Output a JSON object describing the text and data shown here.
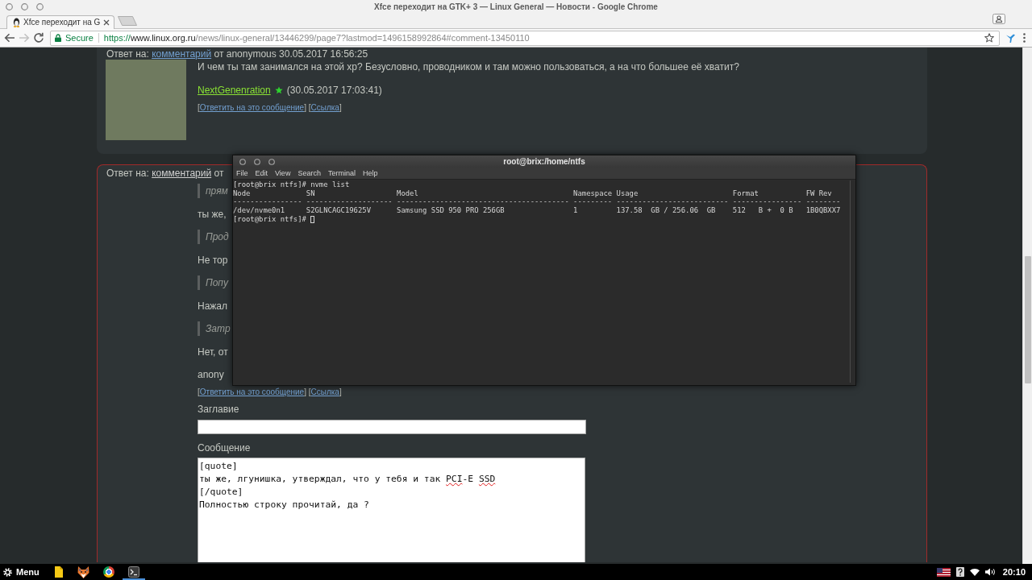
{
  "window": {
    "title": "Xfce переходит на GTK+ 3 — Linux General — Новости - Google Chrome"
  },
  "tabs": [
    {
      "label": "Xfce переходит на G",
      "selected": true
    }
  ],
  "toolbar": {
    "nav": [
      {
        "kind": "back",
        "disabled": false
      },
      {
        "kind": "forward",
        "disabled": true
      },
      {
        "kind": "reload",
        "disabled": false
      }
    ],
    "address": {
      "security": "Secure",
      "scheme": "https://",
      "host": "www.linux.org.ru",
      "path": "/news/linux-general/13446299/page7?lastmod=1496158992864#comment-13450110"
    }
  },
  "comments": [
    {
      "highlighted": false,
      "header": {
        "prefix": "Ответ на:",
        "link": "комментарий",
        "visited": false,
        "suffix": "от anonymous 30.05.2017 16:56:25"
      },
      "avatar": true,
      "body": [
        {
          "kind": "paragraph",
          "text": "И чем ты там занимался на этой xp? Безусловно, проводником и там можно пользоваться, а на что большее её хватит?"
        }
      ],
      "author": {
        "name": "NextGenenration",
        "link": true,
        "starred": true,
        "date": "(30.05.2017 17:03:41)"
      },
      "actions": [
        {
          "kind": "plain",
          "text": "["
        },
        {
          "kind": "link",
          "text": "Ответить на это сообщение"
        },
        {
          "kind": "plain",
          "text": "] ["
        },
        {
          "kind": "link",
          "text": "Ссылка"
        },
        {
          "kind": "plain",
          "text": "]"
        }
      ]
    },
    {
      "highlighted": true,
      "header": {
        "prefix": "Ответ на:",
        "link": "комментарий",
        "visited": true,
        "suffix": "от"
      },
      "avatar": false,
      "body": [
        {
          "kind": "quote",
          "text": "прям"
        },
        {
          "kind": "paragraph",
          "text": "ты же,"
        },
        {
          "kind": "quote",
          "text": "Прод"
        },
        {
          "kind": "paragraph",
          "text": "Не тор"
        },
        {
          "kind": "quote",
          "text": "Попу"
        },
        {
          "kind": "paragraph",
          "text": "Нажал"
        },
        {
          "kind": "quote",
          "text": "Затр"
        },
        {
          "kind": "paragraph",
          "text": "Нет, от"
        }
      ],
      "author": {
        "name": "anony",
        "link": false,
        "starred": false
      },
      "actions": [
        {
          "kind": "plain",
          "text": "["
        },
        {
          "kind": "link",
          "text": "Ответить на это сообщение"
        },
        {
          "kind": "plain",
          "text": "] ["
        },
        {
          "kind": "link",
          "text": "Ссылка"
        },
        {
          "kind": "plain",
          "text": "]"
        }
      ],
      "reply_form": {
        "title_label": "Заглавие",
        "message_label": "Сообщение",
        "message_lines": [
          [
            {
              "kind": "plain",
              "text": "[quote]"
            }
          ],
          [
            {
              "kind": "plain",
              "text": "ты же, лгунишка, утверждал, что у тебя и так "
            },
            {
              "kind": "misspelled",
              "text": "PCI"
            },
            {
              "kind": "plain",
              "text": "-E "
            },
            {
              "kind": "misspelled",
              "text": "SSD"
            }
          ],
          [
            {
              "kind": "plain",
              "text": "[/quote]"
            }
          ],
          [
            {
              "kind": "plain",
              "text": "Полностью строку прочитай, да ?"
            }
          ]
        ]
      }
    }
  ],
  "terminal": {
    "title": "root@brix:/home/ntfs",
    "menu": [
      "File",
      "Edit",
      "View",
      "Search",
      "Terminal",
      "Help"
    ],
    "lines": [
      "[root@brix ntfs]# nvme list",
      "Node             SN                   Model                                    Namespace Usage                      Format           FW Rev",
      "---------------- -------------------- ---------------------------------------- --------- -------------------------- ---------------- --------",
      "/dev/nvme0n1     S2GLNCAGC19625V      Samsung SSD 950 PRO 256GB                1         137.58  GB / 256.06  GB    512   B +  0 B   1B0QBXX7"
    ],
    "prompt": "[root@brix ntfs]#"
  },
  "taskbar": {
    "menu_label": "Menu",
    "apps": [
      {
        "kind": "files",
        "selected": false
      },
      {
        "kind": "fox",
        "selected": false
      },
      {
        "kind": "browser",
        "selected": false
      },
      {
        "kind": "terminal",
        "selected": true
      }
    ],
    "clock": "20:10"
  }
}
